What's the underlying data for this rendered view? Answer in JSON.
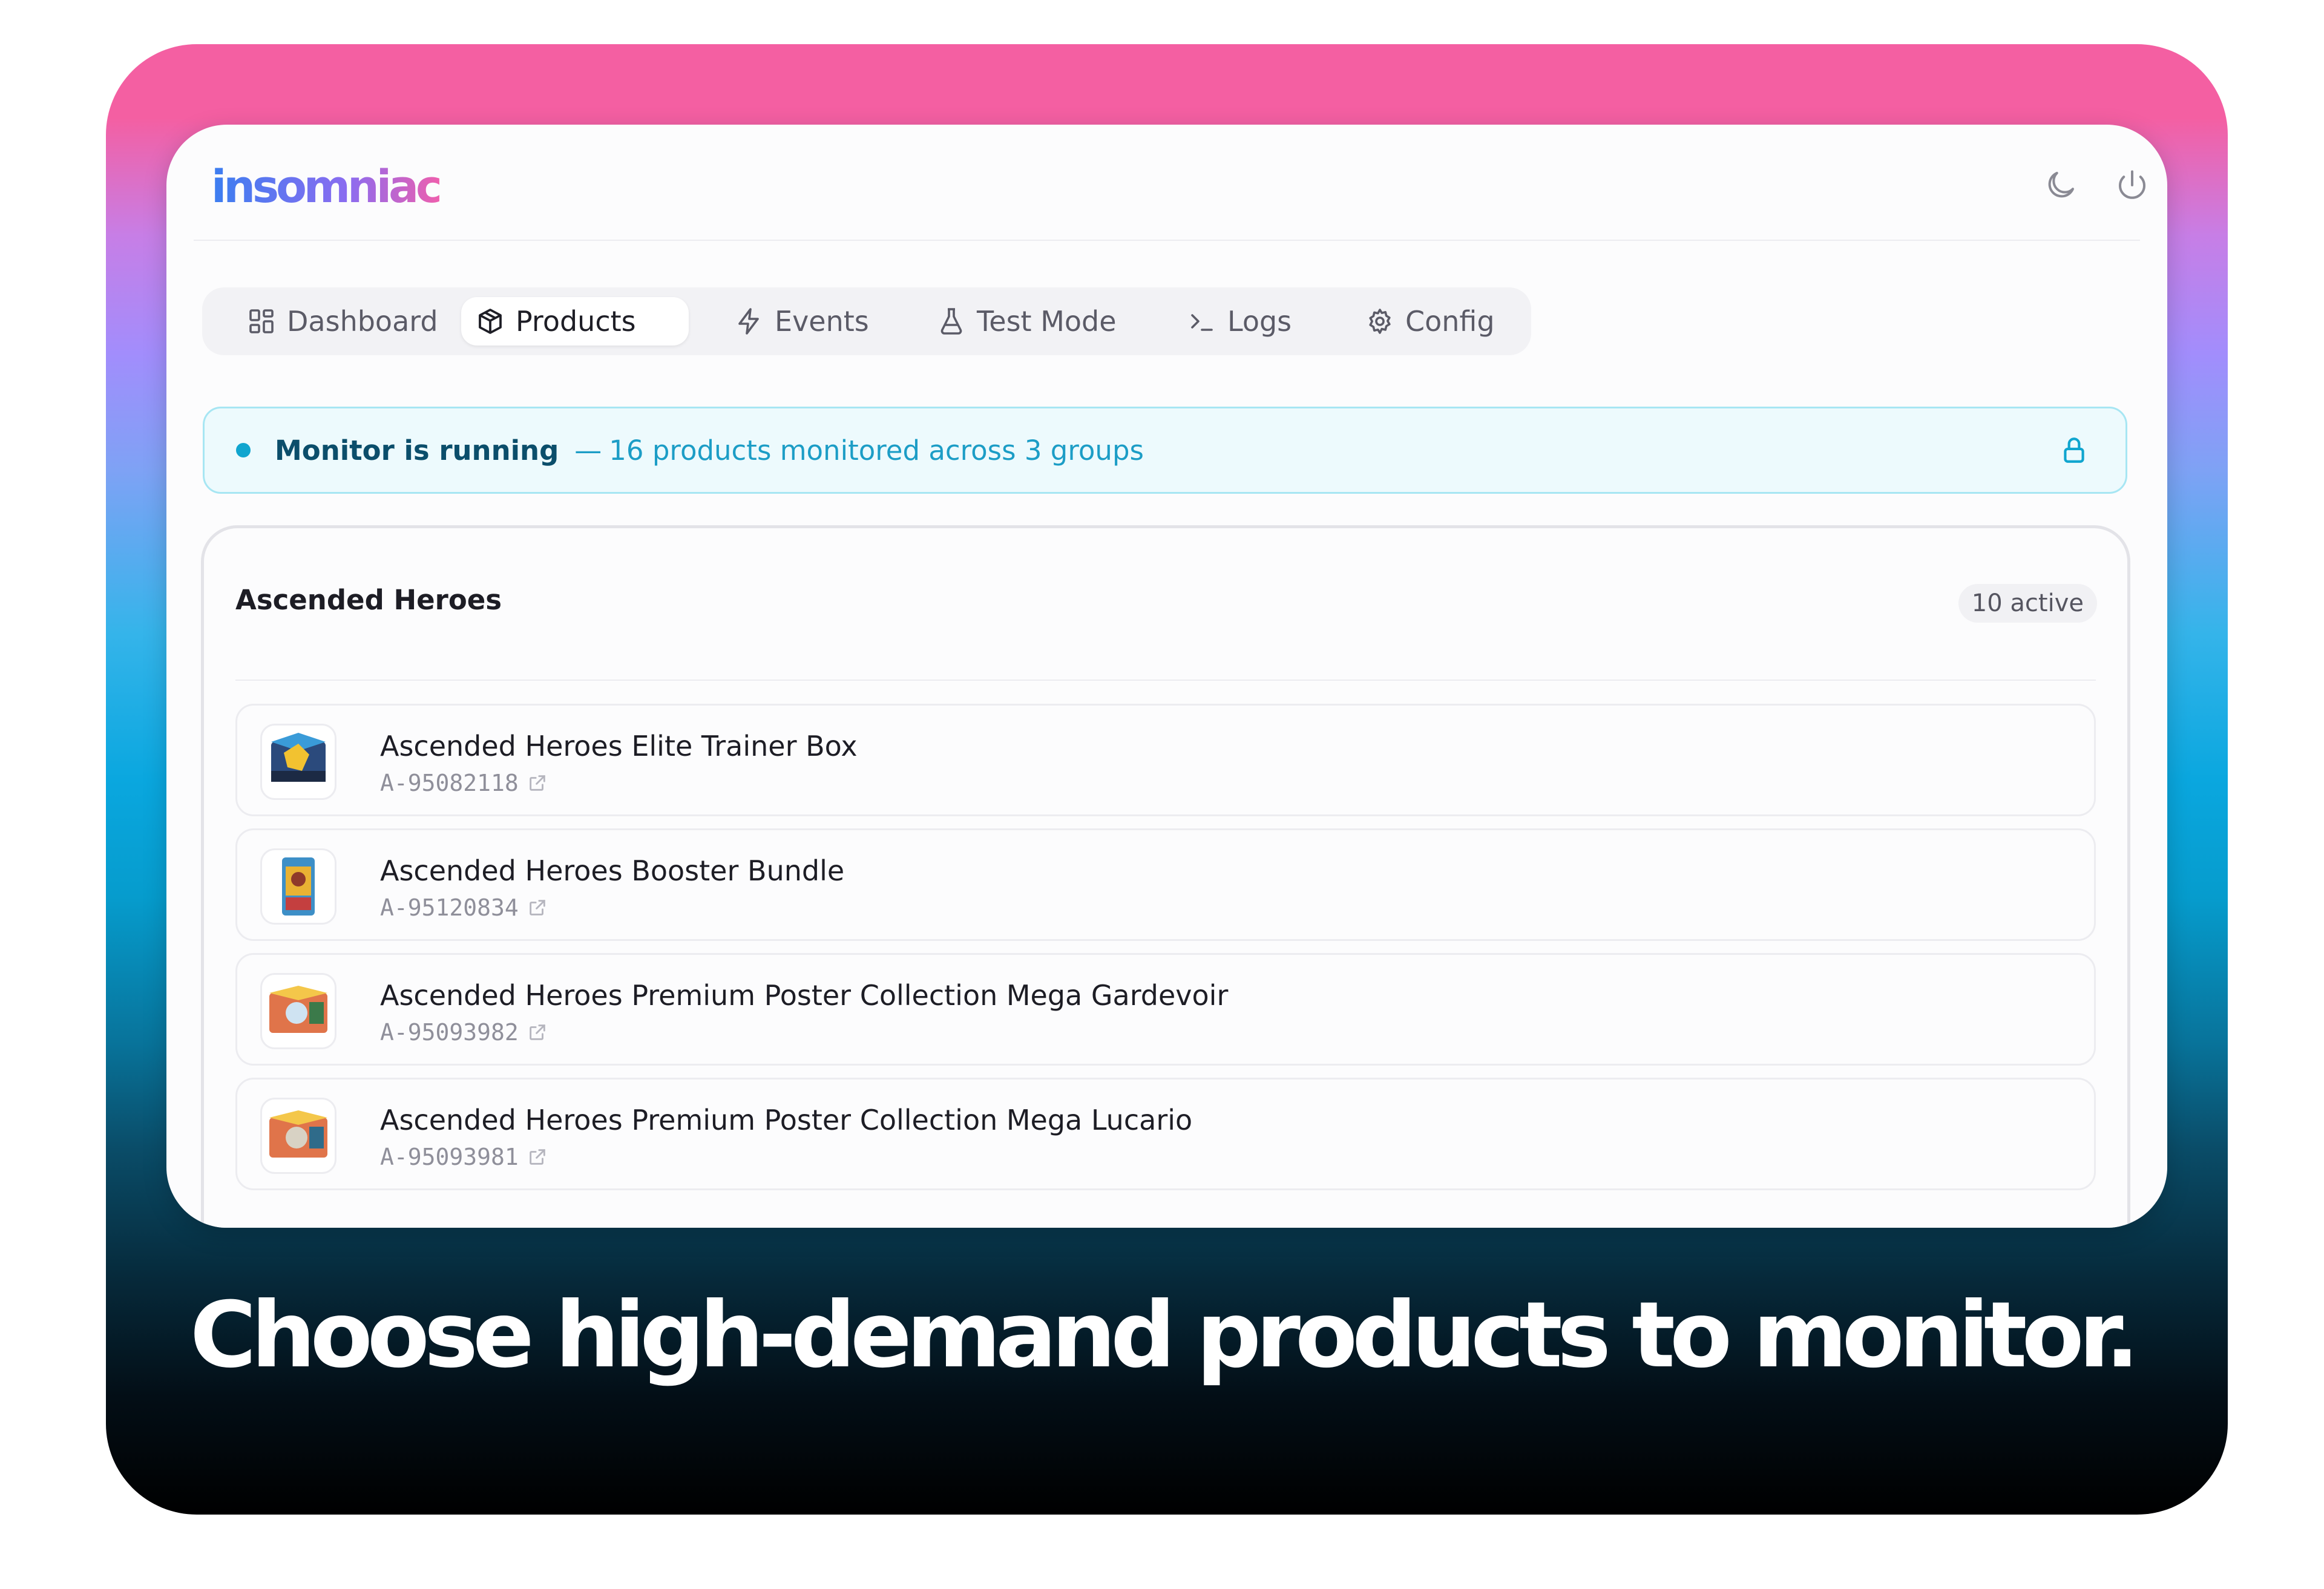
{
  "app": {
    "logo_text": "insomniac"
  },
  "header": {
    "icons": [
      "moon-icon",
      "power-icon"
    ]
  },
  "nav": {
    "tabs": [
      {
        "label": "Dashboard",
        "icon": "dashboard-icon"
      },
      {
        "label": "Products",
        "icon": "box-icon",
        "active": true
      },
      {
        "label": "Events",
        "icon": "lightning-icon"
      },
      {
        "label": "Test Mode",
        "icon": "flask-icon"
      },
      {
        "label": "Logs",
        "icon": "terminal-icon"
      },
      {
        "label": "Config",
        "icon": "gear-icon"
      }
    ]
  },
  "status": {
    "title": "Monitor is running",
    "separator": "—",
    "detail": "16 products monitored across 3 groups",
    "icon": "lock-icon"
  },
  "group": {
    "title": "Ascended Heroes",
    "badge": "10 active",
    "products": [
      {
        "name": "Ascended Heroes Elite Trainer Box",
        "sku": "A-95082118"
      },
      {
        "name": "Ascended Heroes Booster Bundle",
        "sku": "A-95120834"
      },
      {
        "name": "Ascended Heroes Premium Poster Collection Mega Gardevoir",
        "sku": "A-95093982"
      },
      {
        "name": "Ascended Heroes Premium Poster Collection Mega Lucario",
        "sku": "A-95093981"
      }
    ]
  },
  "caption": "Choose high-demand products to monitor.",
  "colors": {
    "accent": "#10a5cf",
    "status_bg": "#edfafd",
    "status_border": "#a7e6f3",
    "gradient_top": "#f45fa2",
    "gradient_bottom": "#000000"
  }
}
